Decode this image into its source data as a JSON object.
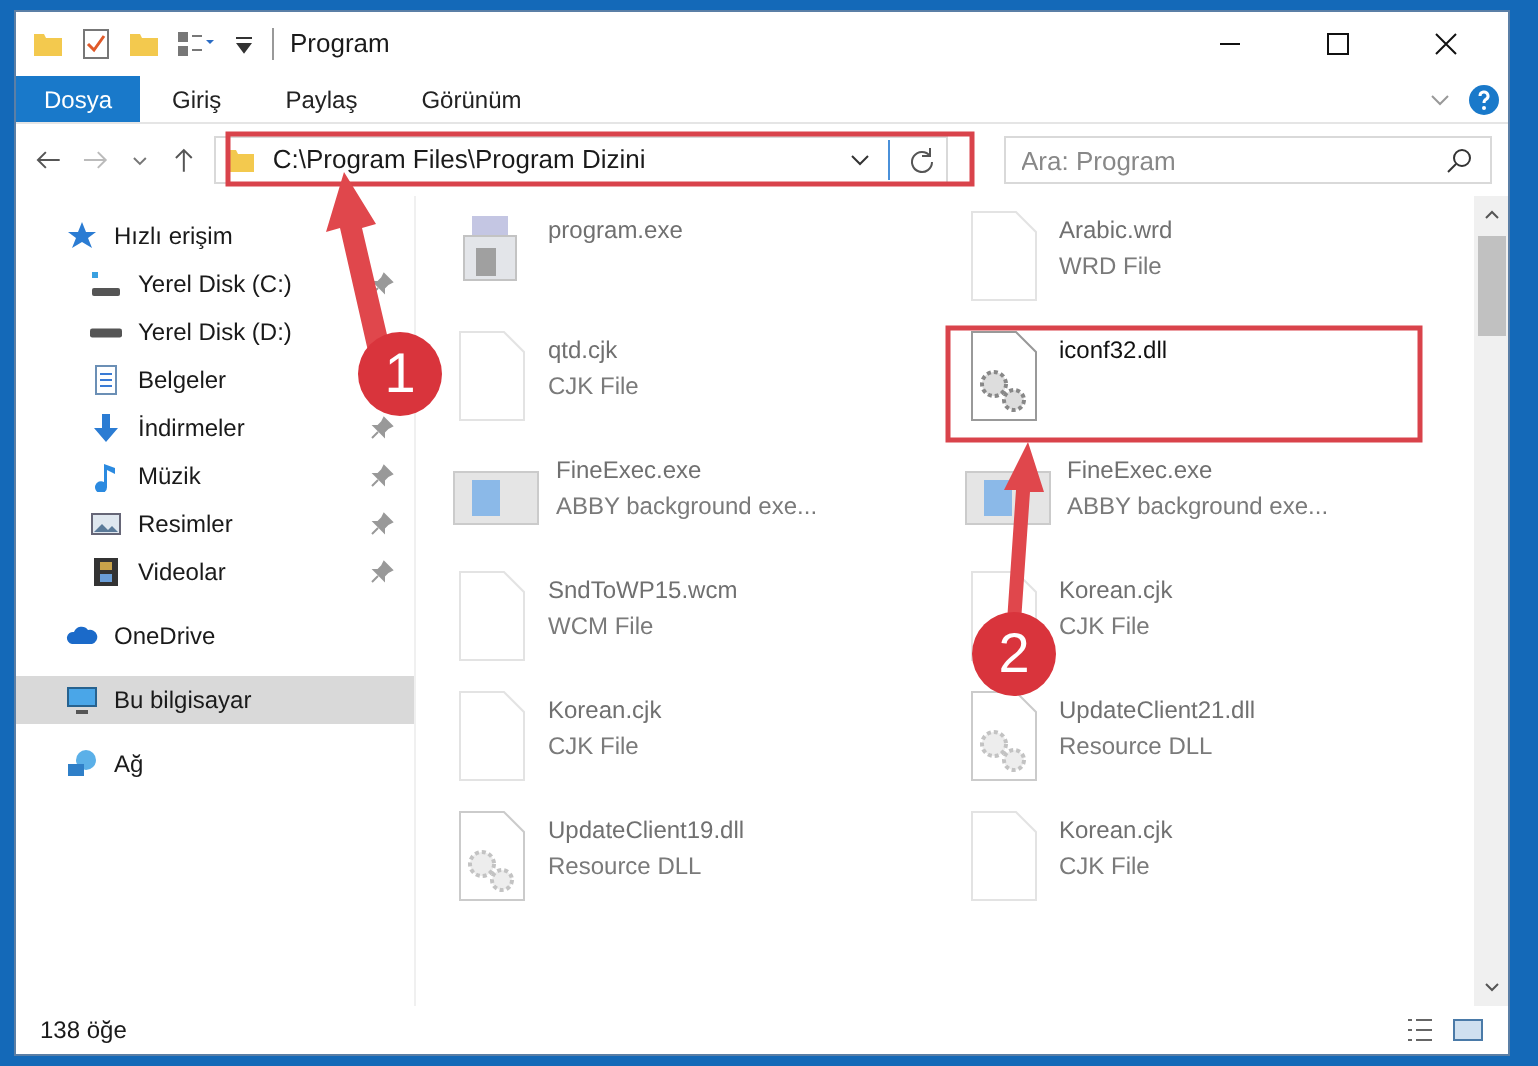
{
  "window": {
    "title": "Program"
  },
  "ribbon_tabs": [
    {
      "label": "Dosya",
      "selected": true
    },
    {
      "label": "Giriş",
      "selected": false
    },
    {
      "label": "Paylaş",
      "selected": false
    },
    {
      "label": "Görünüm",
      "selected": false
    }
  ],
  "address_bar": {
    "path": "C:\\Program Files\\Program Dizini"
  },
  "search": {
    "placeholder": "Ara: Program"
  },
  "nav_pane": [
    {
      "label": "Hızlı erişim",
      "kind": "star",
      "selected": false,
      "children": [
        {
          "label": "Yerel Disk (C:)",
          "kind": "drive-c",
          "pinned": true
        },
        {
          "label": "Yerel Disk (D:)",
          "kind": "drive",
          "pinned": false
        },
        {
          "label": "Belgeler",
          "kind": "docs",
          "pinned": false
        },
        {
          "label": "İndirmeler",
          "kind": "download",
          "pinned": true
        },
        {
          "label": "Müzik",
          "kind": "music",
          "pinned": true
        },
        {
          "label": "Resimler",
          "kind": "pictures",
          "pinned": true
        },
        {
          "label": "Videolar",
          "kind": "videos",
          "pinned": true
        }
      ]
    },
    {
      "label": "OneDrive",
      "kind": "cloud",
      "selected": false
    },
    {
      "label": "Bu bilgisayar",
      "kind": "pc",
      "selected": true
    },
    {
      "label": "Ağ",
      "kind": "network",
      "selected": false
    }
  ],
  "files": [
    {
      "name": "program.exe",
      "kind": "installer",
      "faded": true
    },
    {
      "name": "Arabic.wrd",
      "type": "WRD File",
      "kind": "doc",
      "faded": true
    },
    {
      "name": "qtd.cjk",
      "type": "CJK File",
      "kind": "doc",
      "faded": true
    },
    {
      "name": "iconf32.dll",
      "kind": "dll",
      "faded": false
    },
    {
      "name": "FineExec.exe",
      "type": "ABBY background exe...",
      "kind": "app",
      "faded": true
    },
    {
      "name": "FineExec.exe",
      "type": "ABBY background exe...",
      "kind": "app",
      "faded": true
    },
    {
      "name": "SndToWP15.wcm",
      "type": "WCM File",
      "kind": "doc",
      "faded": true
    },
    {
      "name": "Korean.cjk",
      "type": "CJK File",
      "kind": "doc",
      "faded": true
    },
    {
      "name": "Korean.cjk",
      "type": "CJK File",
      "kind": "doc",
      "faded": true
    },
    {
      "name": "UpdateClient21.dll",
      "type": "Resource DLL",
      "kind": "dll",
      "faded": true
    },
    {
      "name": "UpdateClient19.dll",
      "type": "Resource DLL",
      "kind": "dll",
      "faded": true
    },
    {
      "name": "Korean.cjk",
      "type": "CJK File",
      "kind": "doc",
      "faded": true
    }
  ],
  "status_bar": {
    "count": "138 öğe"
  },
  "annotations": [
    {
      "label": "1"
    },
    {
      "label": "2"
    }
  ]
}
